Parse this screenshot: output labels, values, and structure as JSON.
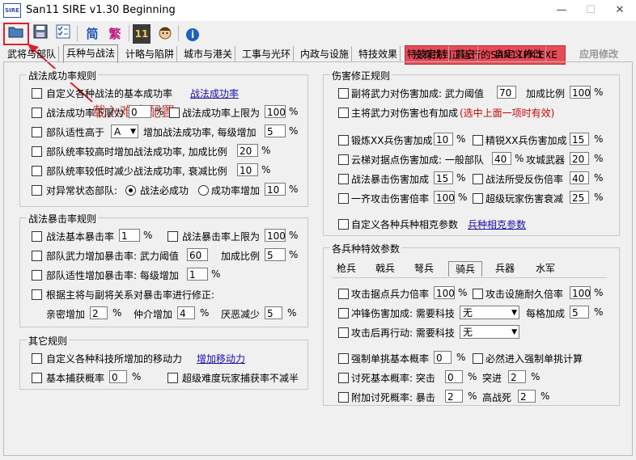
{
  "titlebar": {
    "logo": "SIRE",
    "title": "San11 SIRE v1.30 Beginning",
    "minimize": "—",
    "maximize": "☐",
    "close": "✕"
  },
  "toolbar": {
    "status": "没有找到正运行的SAN11PK.EXE",
    "apply": "应用修改",
    "jian": "简",
    "fan": "繁",
    "info": "i",
    "eleven": "11"
  },
  "overlay": "载入难度配置",
  "tabs": [
    "武将与部队",
    "兵种与战法",
    "计略与陷阱",
    "城市与港关",
    "工事与光环",
    "内政与设施",
    "特技效果",
    "特技定制",
    "其它",
    "自定义修改"
  ],
  "g1": {
    "title": "战法成功率规则",
    "r1": "自定义各种战法的基本成功率",
    "r1link": "战法成功率",
    "r2a": "战法成功率下限为",
    "r2v": "0",
    "r2p": "%",
    "r2b": "战法成功率上限为",
    "r2v2": "100",
    "r2p2": "%",
    "r3a": "部队适性高于",
    "r3sel": "A",
    "r3b": "增加战法成功率, 每级增加",
    "r3v": "5",
    "r3p": "%",
    "r4": "部队统率较高时增加战法成功率, 加成比例",
    "r4v": "20",
    "r4p": "%",
    "r5": "部队统率较低时减少战法成功率, 衰减比例",
    "r5v": "10",
    "r5p": "%",
    "r6": "对异常状态部队:",
    "r6o1": "战法必成功",
    "r6o2": "成功率增加",
    "r6v": "10",
    "r6p": "%"
  },
  "g2": {
    "title": "战法暴击率规则",
    "r1a": "战法基本暴击率",
    "r1v": "1",
    "r1p": "%",
    "r1b": "战法暴击率上限为",
    "r1v2": "100",
    "r1p2": "%",
    "r2a": "部队武力增加暴击率: 武力阈值",
    "r2v": "60",
    "r2b": "加成比例",
    "r2v2": "5",
    "r2p": "%",
    "r3": "部队适性增加暴击率: 每级增加",
    "r3v": "1",
    "r3p": "%",
    "r4": "根据主将与副将关系对暴击率进行修正:",
    "r5a": "亲密增加",
    "r5v1": "2",
    "r5p1": "%",
    "r5b": "仲介增加",
    "r5v2": "4",
    "r5p2": "%",
    "r5c": "厌恶减少",
    "r5v3": "5",
    "r5p3": "%"
  },
  "g3": {
    "title": "其它规则",
    "r1": "自定义各种科技所增加的移动力",
    "r1link": "增加移动力",
    "r2a": "基本捕获概率",
    "r2v": "0",
    "r2p": "%",
    "r2b": "超级难度玩家捕获率不减半"
  },
  "g4": {
    "title": "伤害修正规则",
    "r1a": "副将武力对伤害加成: 武力阈值",
    "r1v": "70",
    "r1b": "加成比例",
    "r1v2": "100",
    "r1p": "%",
    "r2": "主将武力对伤害也有加成",
    "r2red": "(选中上面一项时有效)",
    "r3a": "锻炼XX兵伤害加成",
    "r3v": "10",
    "r3p": "%",
    "r3b": "精锐XX兵伤害加成",
    "r3v2": "15",
    "r3p2": "%",
    "r4a": "云梯对据点伤害加成: 一般部队",
    "r4v": "40",
    "r4p": "%",
    "r4b": "攻城武器",
    "r4v2": "20",
    "r4p2": "%",
    "r5a": "战法暴击伤害加成",
    "r5v": "15",
    "r5p": "%",
    "r5b": "战法所受反伤倍率",
    "r5v2": "40",
    "r5p2": "%",
    "r6a": "一齐攻击伤害倍率",
    "r6v": "100",
    "r6p": "%",
    "r6b": "超级玩家伤害衰减",
    "r6v2": "25",
    "r6p2": "%",
    "r7": "自定义各种兵种相克参数",
    "r7link": "兵种相克参数"
  },
  "g5": {
    "title": "各兵种特效参数",
    "subtabs": [
      "枪兵",
      "戟兵",
      "弩兵",
      "骑兵",
      "兵器",
      "水军"
    ],
    "r1a": "攻击据点兵力倍率",
    "r1v": "100",
    "r1p": "%",
    "r1b": "攻击设施耐久倍率",
    "r1v2": "100",
    "r1p2": "%",
    "r2a": "冲锋伤害加成: 需要科技",
    "r2sel": "无",
    "r2b": "每格加成",
    "r2v": "5",
    "r2p": "%",
    "r3a": "攻击后再行动: 需要科技",
    "r3sel": "无",
    "r4a": "强制单挑基本概率",
    "r4v": "0",
    "r4p": "%",
    "r4b": "必然进入强制单挑计算",
    "r5a": "讨死基本概率: 突击",
    "r5v": "0",
    "r5p": "%",
    "r5b": "突进",
    "r5v2": "2",
    "r5p2": "%",
    "r6a": "附加讨死概率: 暴击",
    "r6v": "2",
    "r6p": "%",
    "r6b": "高战死",
    "r6v2": "2",
    "r6p2": "%"
  }
}
